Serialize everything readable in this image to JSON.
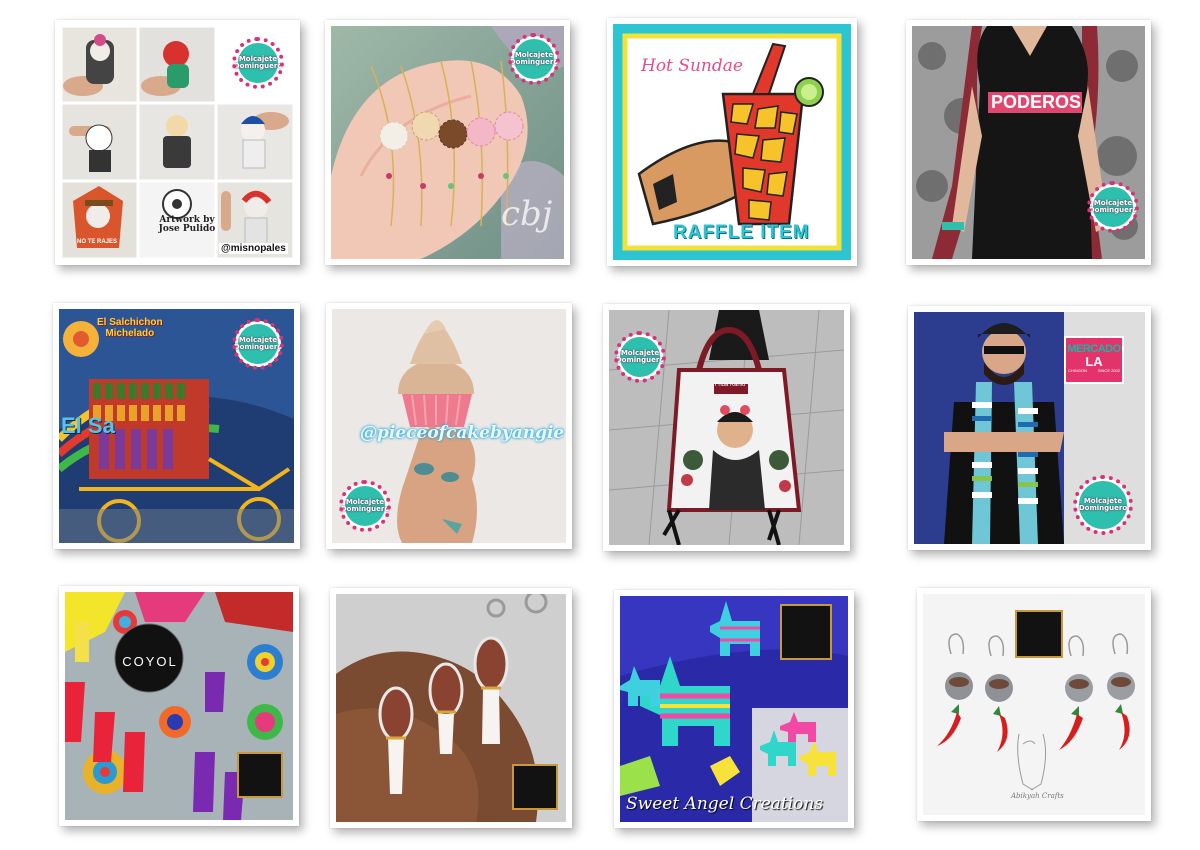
{
  "tiles": [
    {
      "id": "stickers",
      "texts": {
        "artwork": "Artwork by\nJose Pulido",
        "handle": "@misnopales",
        "bean": "NO TE RAJES"
      },
      "badge": "Molcajete\nDominguero"
    },
    {
      "id": "concha-bracelets",
      "texts": {
        "watermark": "cbj"
      },
      "badge": "Molcajete\nDominguero"
    },
    {
      "id": "hot-sundae",
      "texts": {
        "title": "Hot Sundae",
        "raffle": "RAFFLE ITEM"
      }
    },
    {
      "id": "poderosa-shirt",
      "texts": {
        "shirt": "PODEROSA"
      },
      "badge": "Molcajete\nDominguero"
    },
    {
      "id": "micheladas-cart",
      "texts": {
        "sign": "El Salchichon\nMichelado",
        "sign2": "El Sa"
      },
      "badge": "Molcajete\nDominguero"
    },
    {
      "id": "cupcake",
      "texts": {
        "handle": "@pieceofcakebyangie"
      },
      "badge": "Molcajete\nDominguero"
    },
    {
      "id": "frida-bag",
      "texts": {
        "brand": "Frida Kahlo"
      },
      "badge": "Molcajete\nDominguero"
    },
    {
      "id": "mercado-scarf",
      "texts": {
        "mercado": "MERCADO",
        "la": "LA",
        "small_left": "CHINGON",
        "small_right": "SINCE 2002"
      },
      "badge": "Molcajete\nDominguero"
    },
    {
      "id": "coyol-earrings",
      "texts": {
        "brand": "COYOL"
      }
    },
    {
      "id": "stone-spoons",
      "texts": {}
    },
    {
      "id": "pinatas",
      "texts": {
        "brand": "Sweet Angel Creations"
      }
    },
    {
      "id": "chili-earrings",
      "texts": {
        "brand": "Abikyah Crafts"
      }
    }
  ],
  "colors": {
    "teal": "#2fbfae",
    "pink": "#d6337a",
    "gold": "#c69a3a",
    "cyan": "#2ec5d3"
  }
}
